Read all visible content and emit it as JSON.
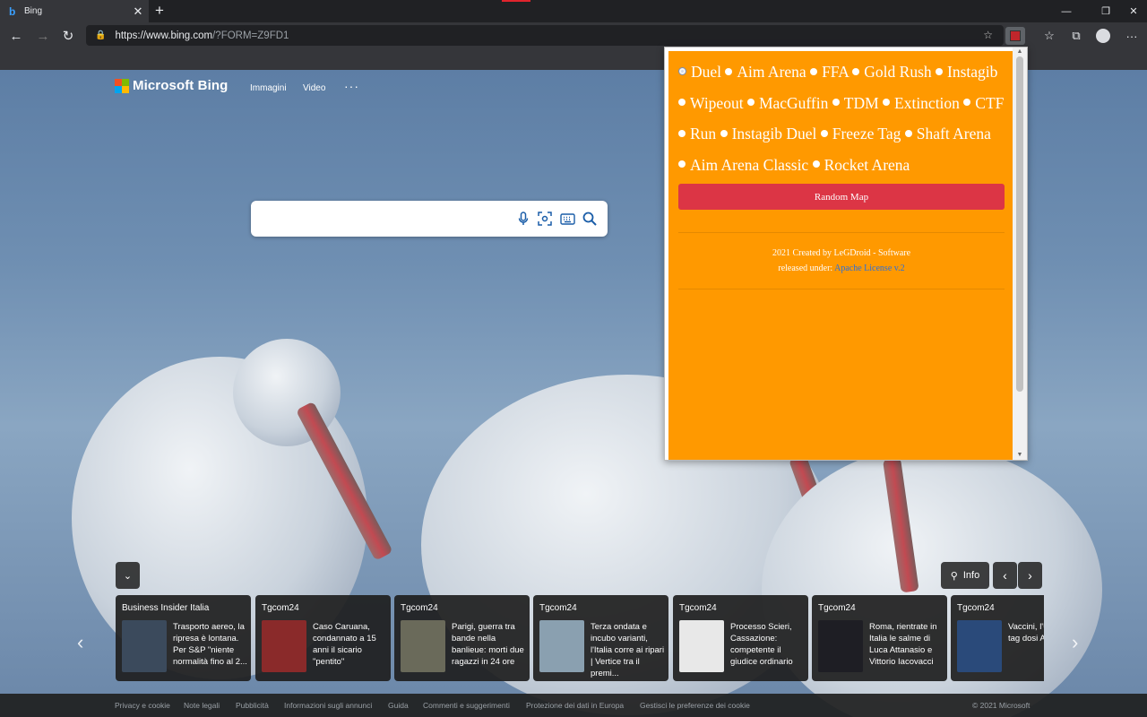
{
  "browser": {
    "tab_title": "Bing",
    "tab_favicon": "b",
    "url_main": "https://www.bing.com",
    "url_rest": "/?FORM=Z9FD1"
  },
  "bing": {
    "brand": "Microsoft Bing",
    "nav": [
      "Immagini",
      "Video"
    ],
    "more": "···",
    "info_label": "Info"
  },
  "news": [
    {
      "source": "Business Insider Italia",
      "headline": "Trasporto aereo, la ripresa è lontana. Per S&P \"niente normalità fino al 2...",
      "thumb_color": "#3b4a5c"
    },
    {
      "source": "Tgcom24",
      "headline": "Caso Caruana, condannato a 15 anni il sicario \"pentito\"",
      "thumb_color": "#8a2a2a"
    },
    {
      "source": "Tgcom24",
      "headline": "Parigi, guerra tra bande nella banlieue: morti due ragazzi in 24 ore",
      "thumb_color": "#6a6a5a"
    },
    {
      "source": "Tgcom24",
      "headline": "Terza ondata e incubo varianti, l'Italia corre ai ripari | Vertice tra il premi...",
      "thumb_color": "#8aa0b0"
    },
    {
      "source": "Tgcom24",
      "headline": "Processo Scieri, Cassazione: competente il giudice ordinario",
      "thumb_color": "#e8e8e8"
    },
    {
      "source": "Tgcom24",
      "headline": "Roma, rientrate in Italia le salme di Luca Attanasio e Vittorio Iacovacci",
      "thumb_color": "#1e1e24"
    },
    {
      "source": "Tgcom24",
      "headline": "Vaccini, l'U nuovo tag dosi Astraz",
      "thumb_color": "#2a4a7a"
    }
  ],
  "footer": {
    "links": [
      "Privacy e cookie",
      "Note legali",
      "Pubblicità",
      "Informazioni sugli annunci",
      "Guida",
      "Commenti e suggerimenti",
      "Protezione dei dati in Europa",
      "Gestisci le preferenze dei cookie"
    ],
    "copyright": "© 2021 Microsoft"
  },
  "popup": {
    "maps": [
      "Duel",
      "Aim Arena",
      "FFA",
      "Gold Rush",
      "Instagib",
      "Wipeout",
      "MacGuffin",
      "TDM",
      "Extinction",
      "CTF",
      "Run",
      "Instagib Duel",
      "Freeze Tag",
      "Shaft Arena",
      "Aim Arena Classic",
      "Rocket Arena"
    ],
    "selected_index": 0,
    "button_label": "Random Map",
    "credit_line1": "2021 Created by LeGDroid - Software",
    "credit_line2_prefix": "released under: ",
    "license_link": "Apache License v.2",
    "bg_color": "#ff9900",
    "button_color": "#dc3545"
  }
}
